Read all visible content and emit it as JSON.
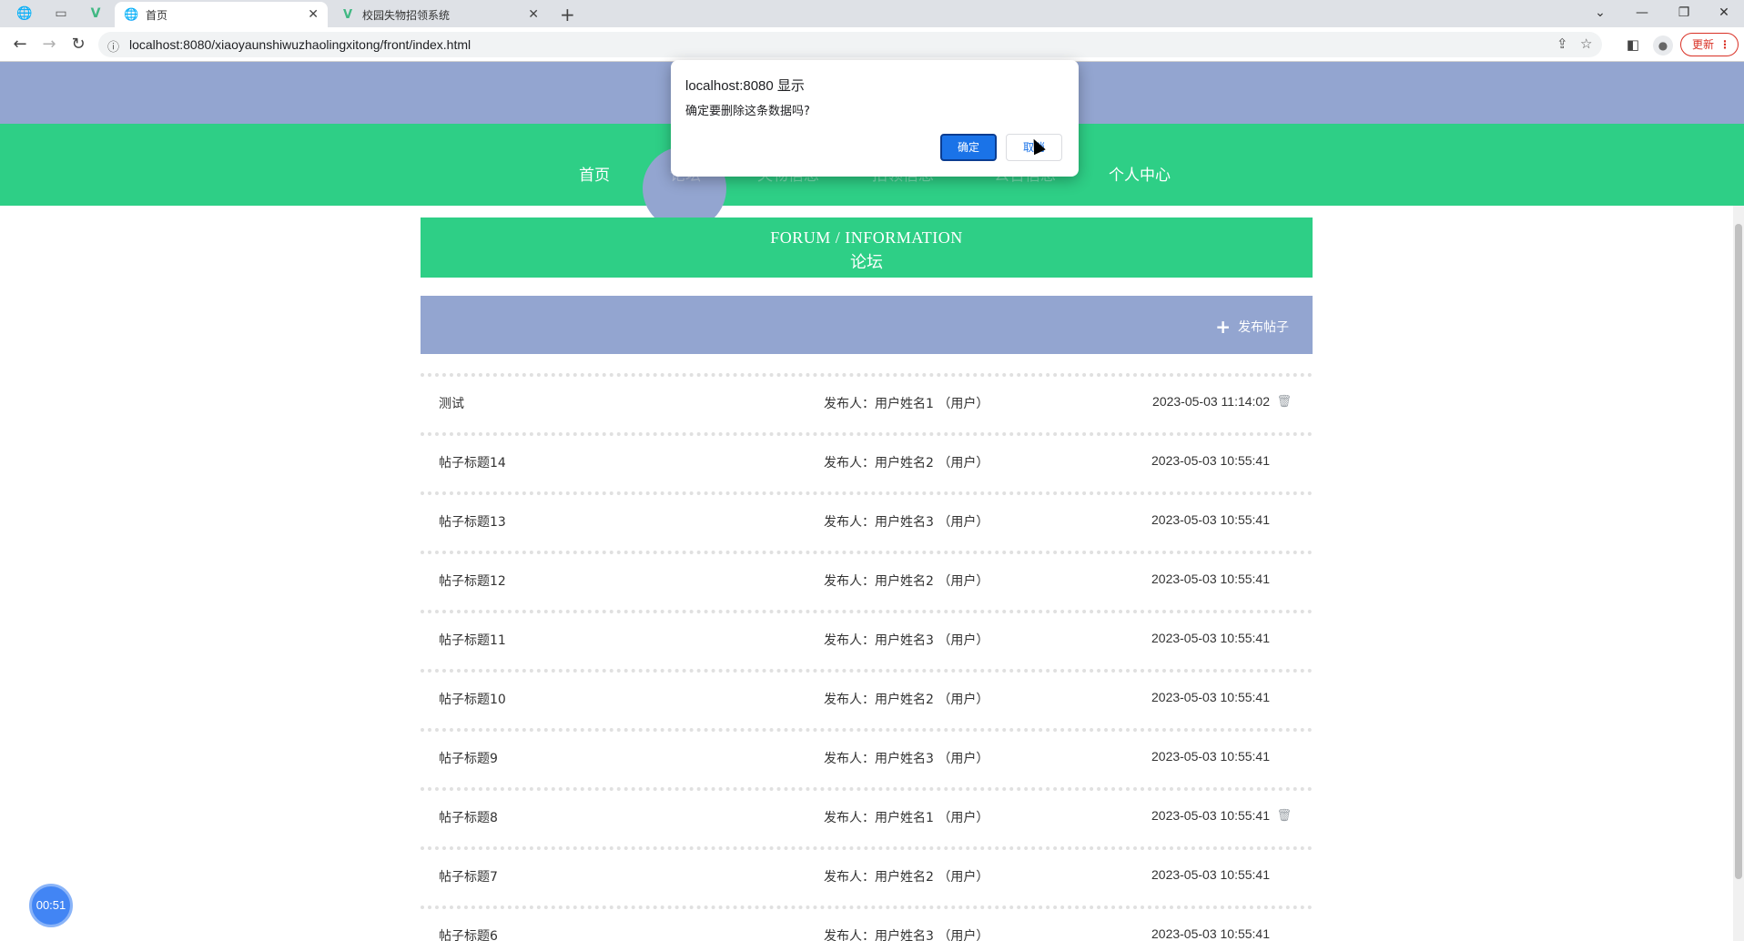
{
  "browser": {
    "tabs": [
      {
        "title": "首页",
        "icon": "globe-icon"
      },
      {
        "title": "校园失物招领系统",
        "icon": "vue-logo-icon"
      }
    ],
    "url": "localhost:8080/xiaoyaunshiwuzhaolingxitong/front/index.html",
    "update_label": "更新"
  },
  "nav": {
    "items": [
      "首页",
      "论坛",
      "失物信息",
      "招领信息",
      "公告信息",
      "个人中心"
    ]
  },
  "section": {
    "title_en": "FORUM / INFORMATION",
    "title_zh": "论坛"
  },
  "actions": {
    "publish_label": "发布帖子"
  },
  "posts": [
    {
      "title": "测试",
      "author": "发布人：用户姓名1 （用户）",
      "date": "2023-05-03 11:14:02",
      "deletable": true
    },
    {
      "title": "帖子标题14",
      "author": "发布人：用户姓名2 （用户）",
      "date": "2023-05-03 10:55:41",
      "deletable": false
    },
    {
      "title": "帖子标题13",
      "author": "发布人：用户姓名3 （用户）",
      "date": "2023-05-03 10:55:41",
      "deletable": false
    },
    {
      "title": "帖子标题12",
      "author": "发布人：用户姓名2 （用户）",
      "date": "2023-05-03 10:55:41",
      "deletable": false
    },
    {
      "title": "帖子标题11",
      "author": "发布人：用户姓名3 （用户）",
      "date": "2023-05-03 10:55:41",
      "deletable": false
    },
    {
      "title": "帖子标题10",
      "author": "发布人：用户姓名2 （用户）",
      "date": "2023-05-03 10:55:41",
      "deletable": false
    },
    {
      "title": "帖子标题9",
      "author": "发布人：用户姓名3 （用户）",
      "date": "2023-05-03 10:55:41",
      "deletable": false
    },
    {
      "title": "帖子标题8",
      "author": "发布人：用户姓名1 （用户）",
      "date": "2023-05-03 10:55:41",
      "deletable": true
    },
    {
      "title": "帖子标题7",
      "author": "发布人：用户姓名2 （用户）",
      "date": "2023-05-03 10:55:41",
      "deletable": false
    },
    {
      "title": "帖子标题6",
      "author": "发布人：用户姓名3 （用户）",
      "date": "2023-05-03 10:55:41",
      "deletable": false
    }
  ],
  "dialog": {
    "title": "localhost:8080 显示",
    "message": "确定要删除这条数据吗?",
    "ok_label": "确定",
    "cancel_label": "取消"
  },
  "timer": "00:51",
  "colors": {
    "nav_green": "#2ecf86",
    "top_blue": "#93a5d0",
    "dialog_blue": "#1a73e8"
  }
}
